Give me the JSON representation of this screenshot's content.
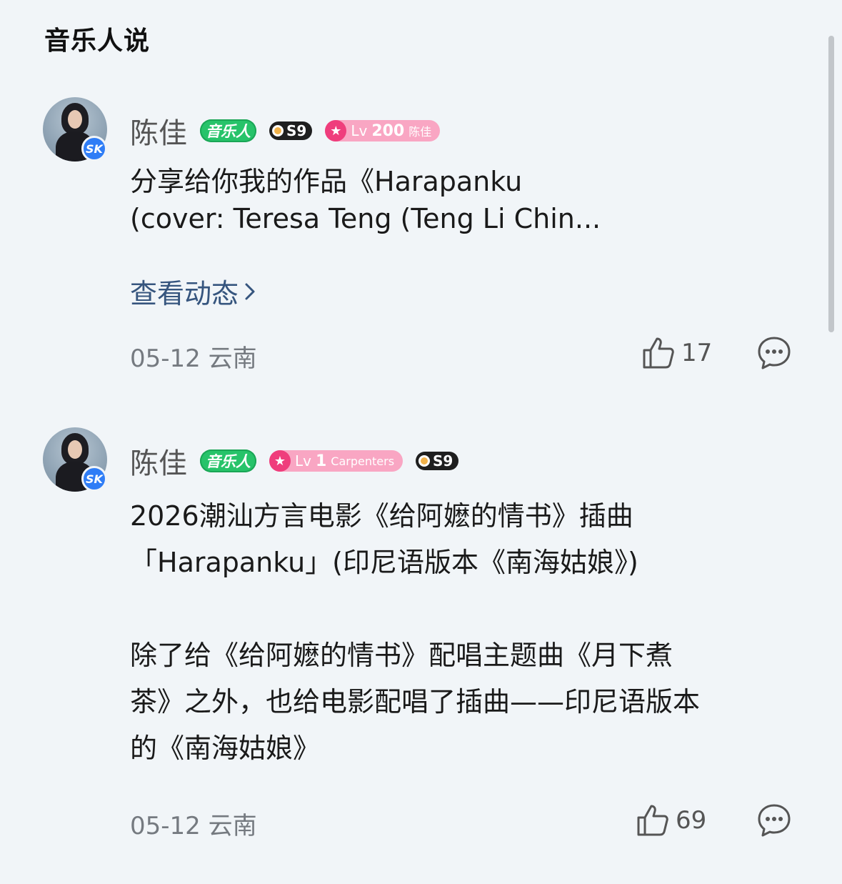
{
  "section": {
    "title": "音乐人说"
  },
  "posts": [
    {
      "user": {
        "name": "陈佳",
        "verify_badge": "SK",
        "badges": {
          "musician": "音乐人",
          "season": "S9",
          "level_prefix": "Lv",
          "level": "200",
          "level_tag": "陈佳"
        }
      },
      "content": [
        "分享给你我的作品《Harapanku",
        "(cover: Teresa Teng (Teng Li Chin..."
      ],
      "view_link": "查看动态",
      "date": "05-12",
      "location": "云南",
      "likes": "17"
    },
    {
      "user": {
        "name": "陈佳",
        "verify_badge": "SK",
        "badges": {
          "musician": "音乐人",
          "level_prefix": "Lv",
          "level": "1",
          "level_tag": "Carpenters",
          "season": "S9"
        }
      },
      "content": [
        "2026潮汕方言电影《给阿嬷的情书》插曲",
        "「Harapanku」(印尼语版本《南海姑娘》)",
        "",
        "除了给《给阿嬷的情书》配唱主题曲《月下煮",
        "茶》之外，也给电影配唱了插曲——印尼语版本",
        "的《南海姑娘》"
      ],
      "date": "05-12",
      "location": "云南",
      "likes": "69"
    }
  ],
  "icons": {
    "like": "thumbs-up-icon",
    "comment": "comment-bubble-icon",
    "chevron": "chevron-right-icon"
  },
  "colors": {
    "background": "#f1f5f8",
    "link": "#36557e",
    "musician_badge": "#27c36a",
    "level_badge": "#f9a6c3",
    "verify": "#2f7df6"
  }
}
